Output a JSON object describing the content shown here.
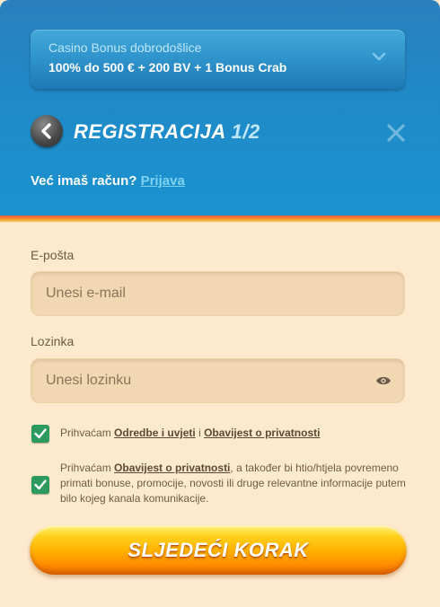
{
  "bonus": {
    "title": "Casino Bonus dobrodošlice",
    "offer": "100% do 500 € + 200 BV + 1 Bonus Crab"
  },
  "header": {
    "title": "REGISTRACIJA",
    "step": "1/2"
  },
  "login": {
    "prompt": "Već imaš račun?",
    "link": "Prijava"
  },
  "email": {
    "label": "E-pošta",
    "placeholder": "Unesi e-mail"
  },
  "password": {
    "label": "Lozinka",
    "placeholder": "Unesi lozinku"
  },
  "consent_terms": {
    "checked": true,
    "prefix": "Prihvaćam",
    "terms_link": "Odredbe i uvjeti",
    "joiner": "i",
    "privacy_link": "Obavijest o privatnosti"
  },
  "consent_marketing": {
    "checked": true,
    "prefix": "Prihvaćam",
    "privacy_link": "Obavijest o privatnosti",
    "rest": ", a također bi htio/htjela povremeno primati bonuse, promocije, novosti ili druge relevantne informacije putem bilo kojeg kanala komunikacije."
  },
  "cta": {
    "label": "SLJEDEĆI KORAK"
  },
  "colors": {
    "header_blue": "#1f8ac7",
    "form_bg": "#fde9cd",
    "checkbox_green": "#2c9a5e",
    "link_blue": "#7fd3f2",
    "cta_orange": "#ffb300"
  },
  "icons": [
    "chevron-down-icon",
    "back-arrow-icon",
    "close-icon",
    "eye-icon",
    "checkmark-icon"
  ]
}
